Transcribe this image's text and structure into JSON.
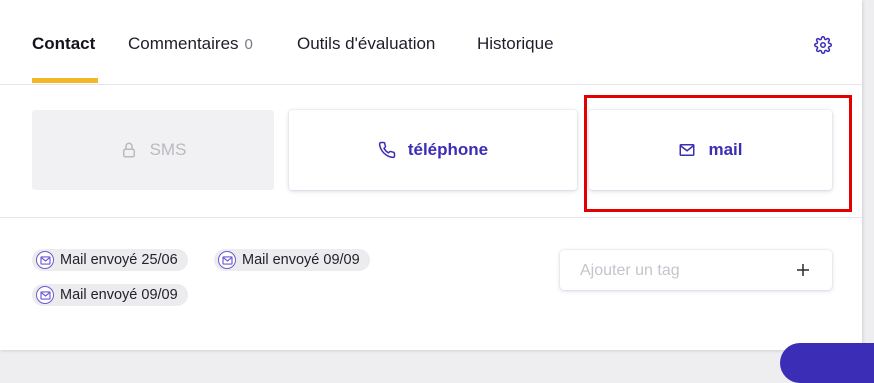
{
  "tabs": [
    {
      "label": "Contact",
      "active": true
    },
    {
      "label": "Commentaires",
      "count": "0"
    },
    {
      "label": "Outils d'évaluation"
    },
    {
      "label": "Historique"
    }
  ],
  "settings_icon": "gear-icon",
  "channels": {
    "sms": {
      "label": "SMS",
      "icon": "lock-icon",
      "state": "disabled"
    },
    "phone": {
      "label": "téléphone",
      "icon": "phone-icon"
    },
    "mail": {
      "label": "mail",
      "icon": "mail-icon",
      "highlighted": true
    }
  },
  "history_chips": [
    {
      "label": "Mail envoyé 25/06",
      "icon": "mail-icon"
    },
    {
      "label": "Mail envoyé 09/09",
      "icon": "mail-icon"
    },
    {
      "label": "Mail envoyé 09/09",
      "icon": "mail-icon"
    }
  ],
  "tag_input": {
    "placeholder": "Ajouter un tag",
    "value": "",
    "add_icon": "plus-icon"
  },
  "colors": {
    "accent": "#3b2db5",
    "active_tab_underline": "#f5b72a",
    "highlight": "#e30000"
  }
}
